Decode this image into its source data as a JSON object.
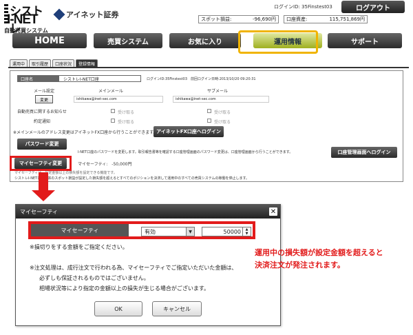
{
  "header": {
    "logo_line1": "シストレ",
    "logo_line2": "I-NET",
    "logo_line3": "自動売買システム",
    "brand": "アイネット証券",
    "login_id": "ログインID: 35Finstest03",
    "logout_label": "ログアウト",
    "metrics": [
      {
        "label": "スポット損益:",
        "value": "-96,690円"
      },
      {
        "label": "口座資産:",
        "value": "115,751,869円"
      }
    ]
  },
  "nav": {
    "items": [
      "HOME",
      "売買システム",
      "お気に入り",
      "運用情報",
      "サポート"
    ],
    "active_index": 3
  },
  "subtabs": [
    "運用中",
    "取引履歴",
    "口座状況",
    "登録情報"
  ],
  "panel": {
    "account_label": "口座名",
    "account_value": "シストレI-NET口座",
    "login_info": "ログインID:35Finstest03　前回ログイン日時:2013/10/20 09:20:31",
    "email_setting": "メール設定",
    "change_label": "変更",
    "main_mail_label": "メインメール",
    "main_mail": "ishikawa@inet-sec.com",
    "sub_mail_label": "サブメール",
    "sub_mail": "ishikawa@inet-sec.com",
    "auto_trade_notice": "自動売買に関するお知らせ",
    "exec_notice": "約定通知",
    "receive": "受け取る",
    "mail_note": "※メインメールのアドレス変更はアイネットFX口座から行うことができます。",
    "fx_login_button": "アイネットFX口座へログイン",
    "password_button": "パスワード変更",
    "password_note": "I-NET口座のパスワードを変更します。取引報告書等を確認する口座管理画面のパスワード変更は、口座管理画面から行うことができます。",
    "account_manage_button": "口座管理画面へログイン",
    "mysafety_button": "マイセーフティ変更",
    "mysafety_info": "マイセーフティ:　-50,000円",
    "mysafety_note1": "マイセーフティは、設定金額以上の損失額を設定できる機能です。",
    "mysafety_note2": "シストレI-NET口座全体のスポット損益が設定した損失額を超えるとすべてのポジションを決済して運用中のすべての売買システムの稼働を停止します。"
  },
  "dialog": {
    "title": "マイセーフティ",
    "row_label": "マイセーフティ",
    "select_value": "有効",
    "amount": "50000",
    "note1": "※損切りをする金額をご指定ください。",
    "note2": "※注文処理は、成行注文で行われる為、マイセーフティでご指定いただいた金額は、",
    "note3": "必ずしも保証されるものではございません。",
    "note4": "相場状況等により指定の金額以上の損失が生じる場合がございます。",
    "ok_label": "OK",
    "cancel_label": "キャンセル"
  },
  "annotation": {
    "line1": "運用中の損失額が設定金額を超えると",
    "line2": "決済注文が発注されます。"
  },
  "colors": {
    "highlight_red": "#e21b1b",
    "highlight_orange": "#f0b400",
    "nav_dark": "#2a2a2a",
    "nav_active": "#9fb020"
  }
}
